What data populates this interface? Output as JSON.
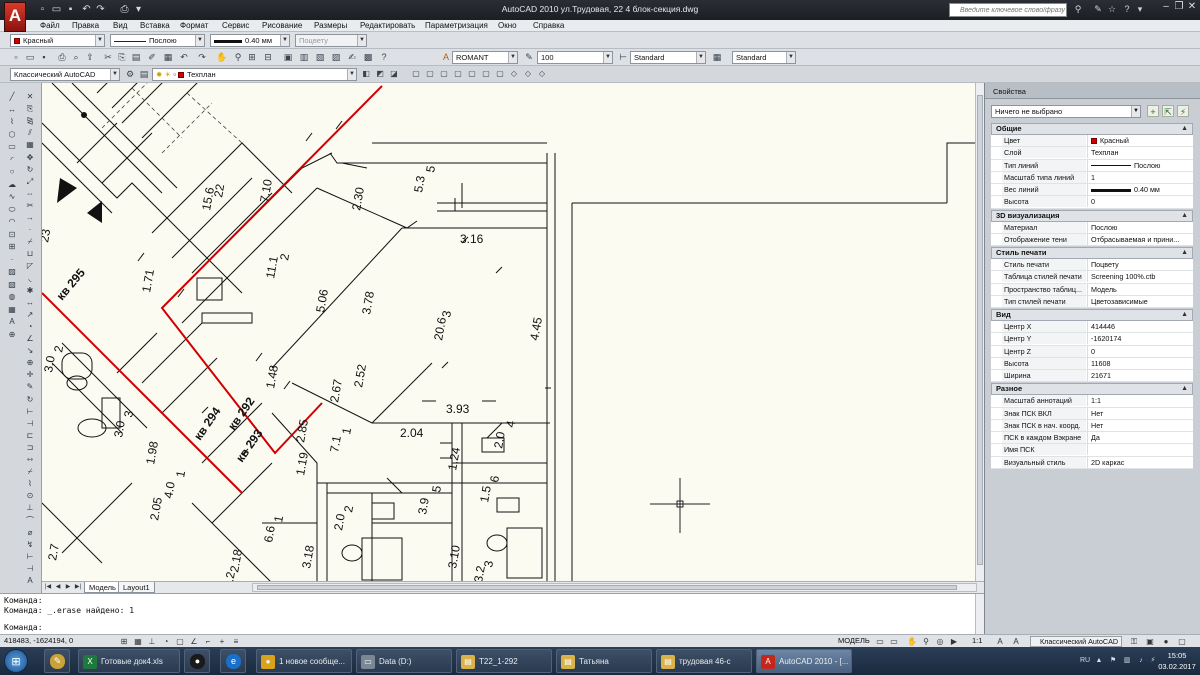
{
  "titlebar": {
    "logo_letter": "A",
    "title": "AutoCAD 2010    ул.Трудовая, 22 4 блок-секция.dwg",
    "search_placeholder": "Введите ключевое слово/фразу"
  },
  "menu": [
    "Файл",
    "Правка",
    "Вид",
    "Вставка",
    "Формат",
    "Сервис",
    "Рисование",
    "Размеры",
    "Редактировать",
    "Параметризация",
    "Окно",
    "Справка"
  ],
  "toolbar": {
    "color": "Красный",
    "linetype": "Послою",
    "lineweight": "0.40 мм",
    "plotstyle": "Поцвету",
    "text_style": "ROMANT",
    "scale": "100",
    "dim_style": "Standard",
    "table_style": "Standard",
    "workspace": "Классический AutoCAD",
    "layer": "Техплан"
  },
  "colors": {
    "accent_red": "#d00000",
    "canvas_bg": "#fbfbf2",
    "panel_bg": "#c9ced4",
    "taskbar": "#1f3047"
  },
  "drawing": {
    "room_labels": [
      {
        "num": "22",
        "area": "15.6"
      },
      {
        "num": "2",
        "area": "11.1"
      },
      {
        "num": "3",
        "area": "20.6"
      },
      {
        "num": "5",
        "area": "3.9"
      },
      {
        "num": "6",
        "area": "1.5"
      },
      {
        "num": "4",
        "area": "2.0"
      },
      {
        "num": "1",
        "area": "7.1"
      },
      {
        "num": "1",
        "area": "4.0"
      },
      {
        "num": "1",
        "area": "6.6"
      },
      {
        "num": "3",
        "area": "3.0"
      },
      {
        "num": "2",
        "area": "3.0"
      },
      {
        "num": "2",
        "area": "2.0"
      },
      {
        "num": "5",
        "area": "5.3"
      },
      {
        "num": "3",
        "area": "3.2"
      }
    ],
    "dimensions": [
      "7.10",
      "2.30",
      "3.16",
      "4.45",
      "3.78",
      "5.06",
      "1.71",
      "1.48",
      "2.52",
      "2.67",
      "3.93",
      "2.04",
      "1.24",
      "2.85",
      "1.19",
      "1.98",
      "2.05",
      "3.18",
      "3.10",
      "2.18",
      "2.7",
      "23",
      "2.2"
    ],
    "apartment_labels": [
      "кв 295",
      "кв 292",
      "кв 294",
      "кв 293"
    ]
  },
  "tabs": {
    "model": "Модель",
    "layout": "Layout1"
  },
  "command": {
    "line1": "Команда:",
    "line2": "Команда: _.erase найдено: 1",
    "prompt": "Команда:"
  },
  "status": {
    "coords": "418483, -1624194, 0",
    "model": "МОДЕЛЬ",
    "scale": "1:1",
    "workspace": "Классический AutoCAD"
  },
  "properties": {
    "title": "Свойства",
    "selection": "Ничего не выбрано",
    "sections": [
      {
        "name": "Общие",
        "rows": [
          {
            "k": "Цвет",
            "v": "Красный",
            "kind": "swatch"
          },
          {
            "k": "Слой",
            "v": "Техплан"
          },
          {
            "k": "Тип линий",
            "v": "Послою",
            "kind": "line"
          },
          {
            "k": "Масштаб типа линий",
            "v": "1"
          },
          {
            "k": "Вес линий",
            "v": "0.40 мм",
            "kind": "thickline"
          },
          {
            "k": "Высота",
            "v": "0"
          }
        ]
      },
      {
        "name": "3D визуализация",
        "rows": [
          {
            "k": "Материал",
            "v": "Послою"
          },
          {
            "k": "Отображение тени",
            "v": "Отбрасываемая и прини..."
          }
        ]
      },
      {
        "name": "Стиль печати",
        "rows": [
          {
            "k": "Стиль печати",
            "v": "Поцвету"
          },
          {
            "k": "Таблица стилей печати",
            "v": "Screening 100%.ctb"
          },
          {
            "k": "Пространство таблиц...",
            "v": "Модель"
          },
          {
            "k": "Тип стилей печати",
            "v": "Цветозависимые"
          }
        ]
      },
      {
        "name": "Вид",
        "rows": [
          {
            "k": "Центр X",
            "v": "414446"
          },
          {
            "k": "Центр Y",
            "v": "-1620174"
          },
          {
            "k": "Центр Z",
            "v": "0"
          },
          {
            "k": "Высота",
            "v": "11608"
          },
          {
            "k": "Ширина",
            "v": "21671"
          }
        ]
      },
      {
        "name": "Разное",
        "rows": [
          {
            "k": "Масштаб аннотаций",
            "v": "1:1"
          },
          {
            "k": "Знак ПСК ВКЛ",
            "v": "Нет"
          },
          {
            "k": "Знак ПСК в нач. коорд.",
            "v": "Нет"
          },
          {
            "k": "ПСК в каждом Вэкране",
            "v": "Да"
          },
          {
            "k": "Имя ПСК",
            "v": ""
          },
          {
            "k": "Визуальный стиль",
            "v": "2D каркас"
          }
        ]
      }
    ]
  },
  "taskbar": {
    "items": [
      {
        "label": "Готовые док4.xls",
        "icon": "X",
        "color": "#1e7a3c"
      },
      {
        "label": "1 новое сообще...",
        "icon": "●",
        "color": "#d9a21b"
      },
      {
        "label": "Data (D:)",
        "icon": "▭",
        "color": "#7b8794"
      },
      {
        "label": "T22_1-292",
        "icon": "▤",
        "color": "#d9b24a"
      },
      {
        "label": "Татьяна",
        "icon": "▤",
        "color": "#d9b24a"
      },
      {
        "label": "трудовая 46-с",
        "icon": "▤",
        "color": "#d9b24a"
      },
      {
        "label": "AutoCAD 2010 - [...",
        "icon": "A",
        "color": "#c3281b"
      }
    ],
    "time": "15:05",
    "date": "03.02.2017"
  }
}
